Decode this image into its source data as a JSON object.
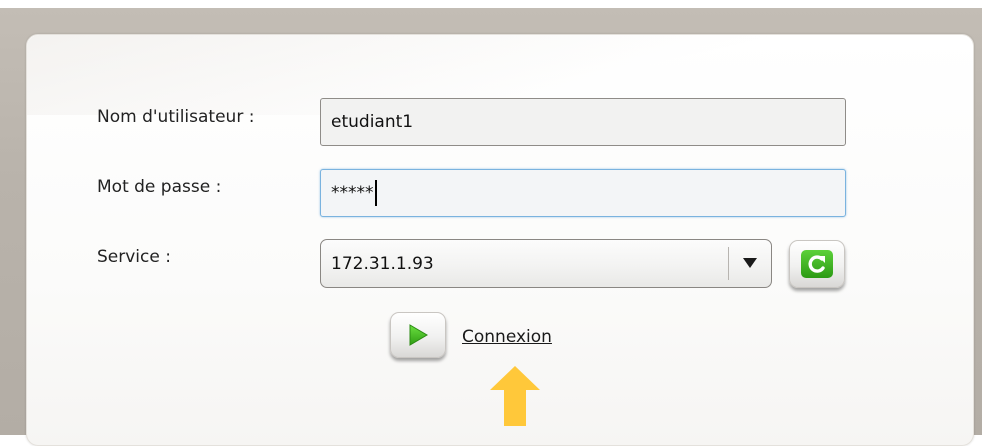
{
  "login_form": {
    "username": {
      "label": "Nom d'utilisateur :",
      "value": "etudiant1"
    },
    "password": {
      "label": "Mot de passe :",
      "value": "*****"
    },
    "service": {
      "label": "Service :",
      "selected": "172.31.1.93"
    },
    "connect": {
      "label": "Connexion"
    }
  },
  "icons": {
    "refresh": "refresh-icon",
    "play": "play-icon",
    "dropdown": "chevron-down-icon",
    "hint_arrow": "arrow-up-icon"
  },
  "colors": {
    "accent_green": "#3fae1f",
    "hint_arrow": "#ffc83a",
    "focus_border": "#7ab3df"
  }
}
